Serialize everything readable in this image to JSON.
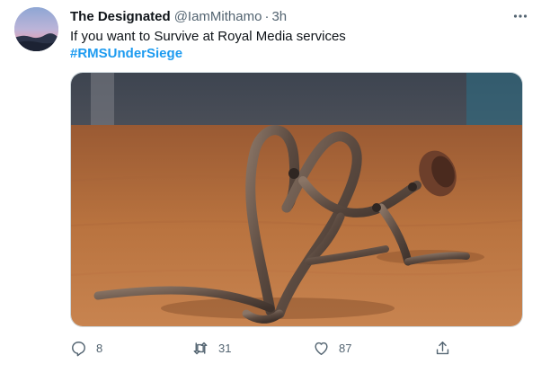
{
  "tweet": {
    "display_name": "The Designated",
    "handle": "@IamMithamo",
    "separator": "·",
    "time": "3h",
    "text": "If you want to Survive at Royal Media services",
    "hashtag": "#RMSUnderSiege",
    "more_icon": "more-horizontal-icon",
    "media_description_icon": "photo"
  },
  "actions": {
    "reply": {
      "icon": "reply-icon",
      "count": "8"
    },
    "retweet": {
      "icon": "retweet-icon",
      "count": "31"
    },
    "like": {
      "icon": "heart-icon",
      "count": "87"
    },
    "share": {
      "icon": "share-icon"
    }
  },
  "colors": {
    "link": "#1d9bf0",
    "muted": "#536471",
    "text": "#0f1419"
  }
}
